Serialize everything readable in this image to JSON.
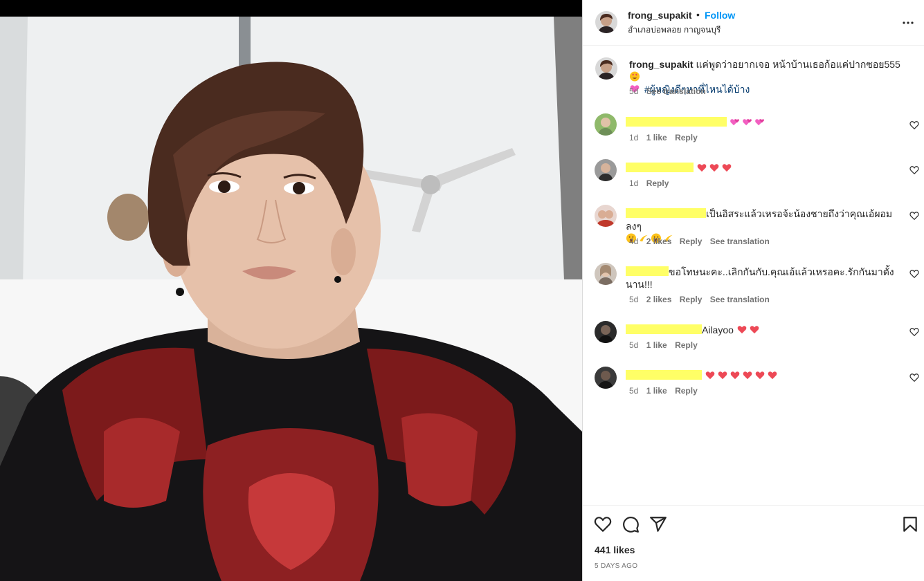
{
  "post": {
    "username": "frong_supakit",
    "separator": "•",
    "follow_label": "Follow",
    "location": "อำเภอบ่อพลอย กาญจนบุรี",
    "more_icon": "more-horizontal-icon"
  },
  "caption": {
    "username": "frong_supakit",
    "text": "แค่พูดว่าอยากเจอ หน้าบ้านเธอก้อแค่ปากซอย555",
    "hashtag": "#ผู้หญิงดีๆหาที่ไหนได้บ้าง",
    "age": "5d",
    "translate_label": "See translation"
  },
  "comments": [
    {
      "text": "",
      "age": "1d",
      "likes": "1 like",
      "reply": "Reply",
      "translate": ""
    },
    {
      "text": "",
      "age": "1d",
      "likes": "",
      "reply": "Reply",
      "translate": ""
    },
    {
      "text": "เป็นอิสระแล้วเหรอจ้ะน้องชายถึงว่าคุณเอ้ผอมลงๆ",
      "age": "4d",
      "likes": "2 likes",
      "reply": "Reply",
      "translate": "See translation"
    },
    {
      "text": "ขอโทษนะคะ..เลิกกันกับ.คุณเอ้แล้วเหรอคะ.รักกันมาตั้งนาน!!!",
      "age": "5d",
      "likes": "2 likes",
      "reply": "Reply",
      "translate": "See translation"
    },
    {
      "text": "Ailayoo",
      "age": "5d",
      "likes": "1 like",
      "reply": "Reply",
      "translate": ""
    },
    {
      "text": "",
      "age": "5d",
      "likes": "1 like",
      "reply": "Reply",
      "translate": ""
    }
  ],
  "footer": {
    "likes": "441 likes",
    "date": "5 DAYS AGO",
    "icons": [
      "heart-icon",
      "comment-icon",
      "share-icon",
      "bookmark-icon"
    ]
  },
  "colors": {
    "link": "#0095f6",
    "hashtag": "#00376b",
    "muted": "#737373",
    "redaction": "#ffff66",
    "heart": "#ed4956"
  }
}
